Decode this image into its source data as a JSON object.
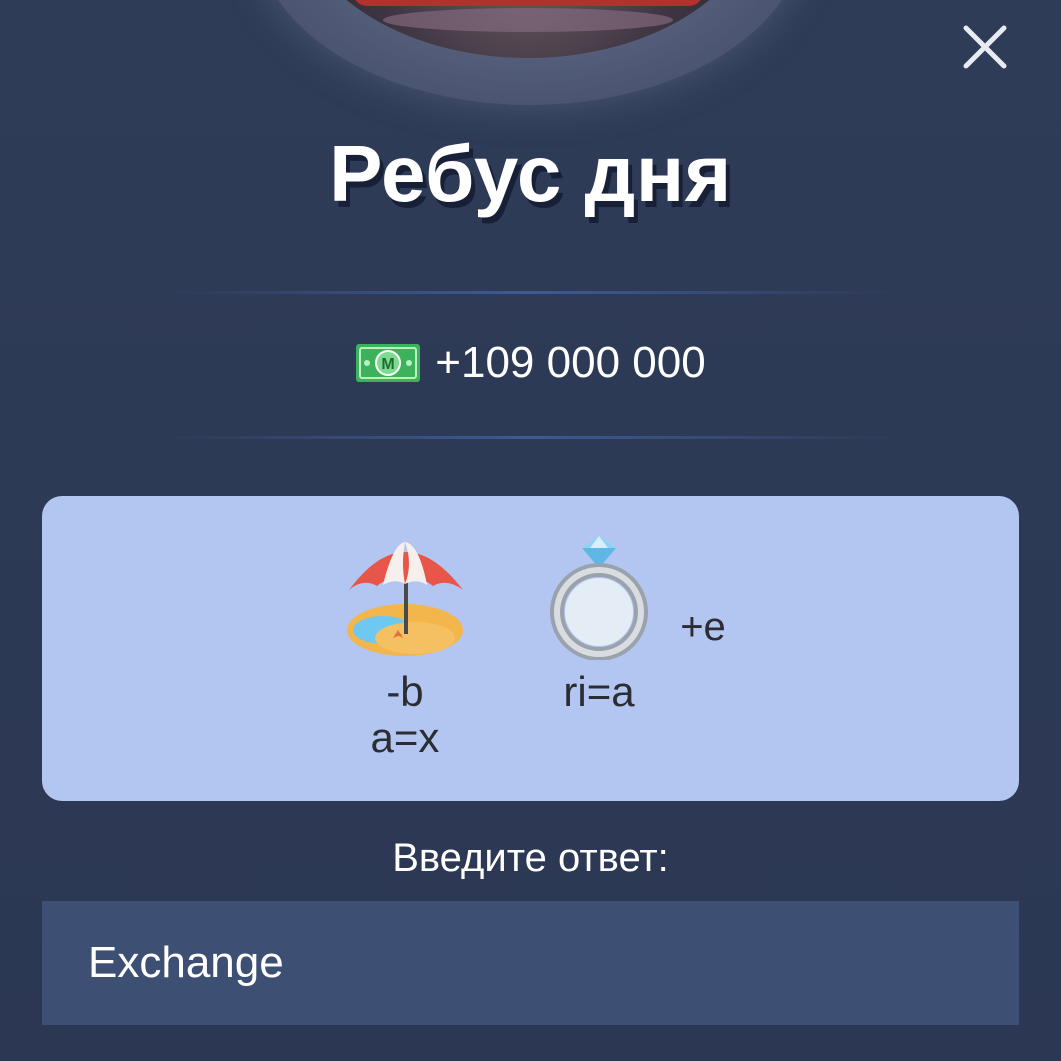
{
  "header": {
    "title": "Ребус дня",
    "close_icon": "close-icon"
  },
  "reward": {
    "icon": "money-icon",
    "icon_letter": "M",
    "amount": "+109 000 000"
  },
  "puzzle": {
    "items": [
      {
        "icon": "beach-umbrella-icon",
        "lines": [
          "-b",
          "a=x"
        ]
      },
      {
        "icon": "ring-icon",
        "lines": [
          "ri=a"
        ]
      },
      {
        "text": "+e"
      }
    ]
  },
  "answer": {
    "label": "Введите ответ:",
    "value": "Exchange",
    "placeholder": ""
  },
  "colors": {
    "background": "#2d3a56",
    "card": "#b3c6f2",
    "input": "#3d4f73",
    "money": "#3cb35a"
  }
}
